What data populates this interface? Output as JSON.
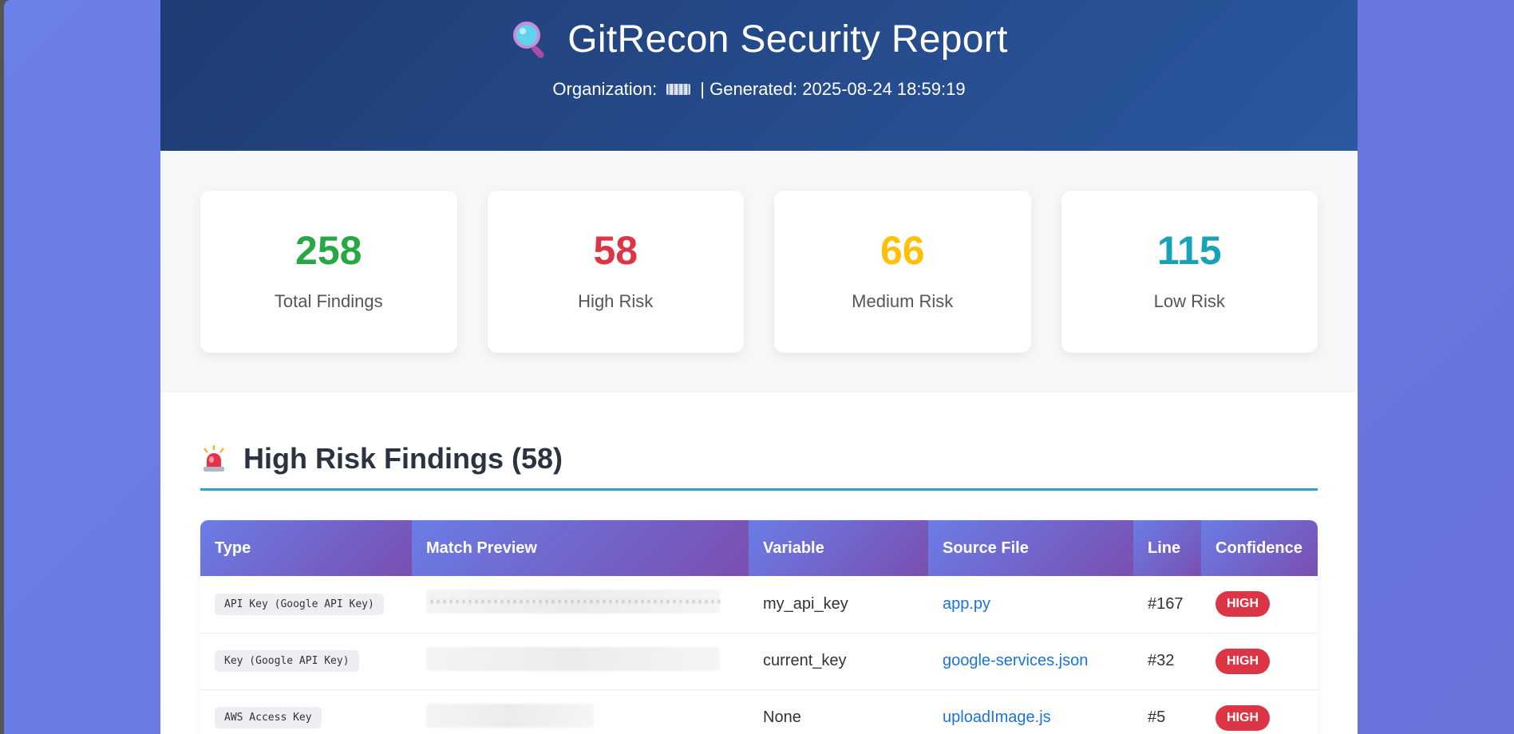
{
  "header": {
    "title": "GitRecon Security Report",
    "org_label": "Organization:",
    "generated_label": "| Generated: 2025-08-24 18:59:19"
  },
  "stats": [
    {
      "value": "258",
      "label": "Total Findings",
      "color": "#28a745"
    },
    {
      "value": "58",
      "label": "High Risk",
      "color": "#dc3545"
    },
    {
      "value": "66",
      "label": "Medium Risk",
      "color": "#ffc107"
    },
    {
      "value": "115",
      "label": "Low Risk",
      "color": "#17a2b8"
    }
  ],
  "section": {
    "title": "High Risk Findings (58)",
    "icon": "siren-icon"
  },
  "table": {
    "headers": [
      "Type",
      "Match Preview",
      "Variable",
      "Source File",
      "Line",
      "Confidence"
    ],
    "rows": [
      {
        "type": "API Key (Google API Key)",
        "variable": "my_api_key",
        "file": "app.py",
        "line": "#167",
        "confidence": "HIGH"
      },
      {
        "type": "Key (Google API Key)",
        "variable": "current_key",
        "file": "google-services.json",
        "line": "#32",
        "confidence": "HIGH"
      },
      {
        "type": "AWS Access Key",
        "variable": "None",
        "file": "uploadImage.js",
        "line": "#5",
        "confidence": "HIGH"
      }
    ]
  },
  "colors": {
    "header_start": "#1f3c73",
    "header_end": "#2b58a0",
    "accent": "#2a9fd6",
    "badge_high": "#dc3545",
    "link": "#1a73d9"
  }
}
